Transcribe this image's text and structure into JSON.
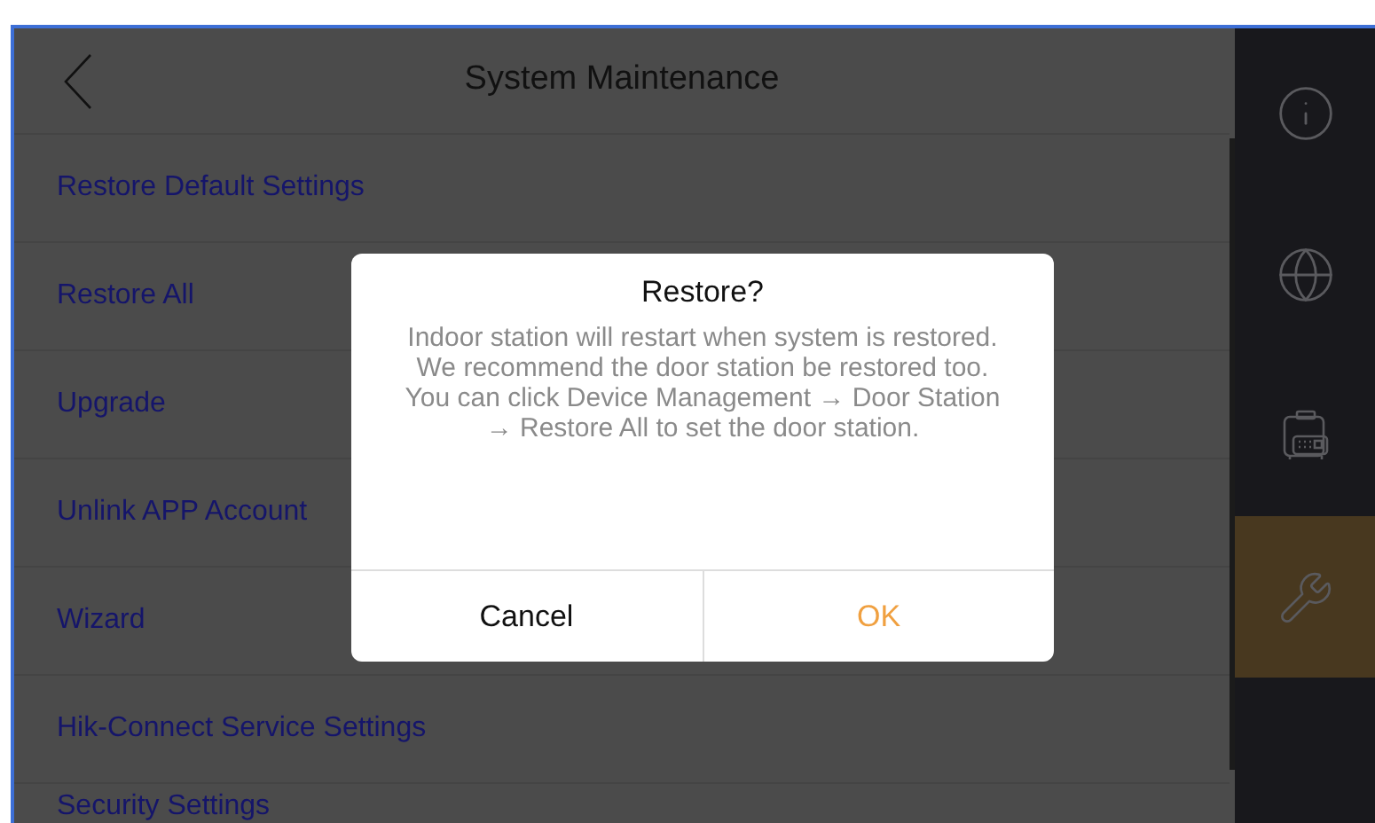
{
  "header": {
    "title": "System Maintenance"
  },
  "menu_items": [
    {
      "label": "Restore Default Settings"
    },
    {
      "label": "Restore All"
    },
    {
      "label": "Upgrade"
    },
    {
      "label": "Unlink APP Account"
    },
    {
      "label": "Wizard"
    },
    {
      "label": "Hik-Connect Service Settings"
    },
    {
      "label": "Security Settings"
    }
  ],
  "sidebar": [
    {
      "kind": "info",
      "selected": false
    },
    {
      "kind": "globe",
      "selected": false
    },
    {
      "kind": "device",
      "selected": false
    },
    {
      "kind": "tools",
      "selected": true
    }
  ],
  "dialog": {
    "title": "Restore?",
    "message": "Indoor station will restart when system is restored. We recommend the door station be restored too. You can click Device Management → Door Station → Restore All to set the door station.",
    "buttons": [
      {
        "label": "Cancel",
        "kind": "cancel"
      },
      {
        "label": "OK",
        "kind": "confirm"
      }
    ]
  }
}
